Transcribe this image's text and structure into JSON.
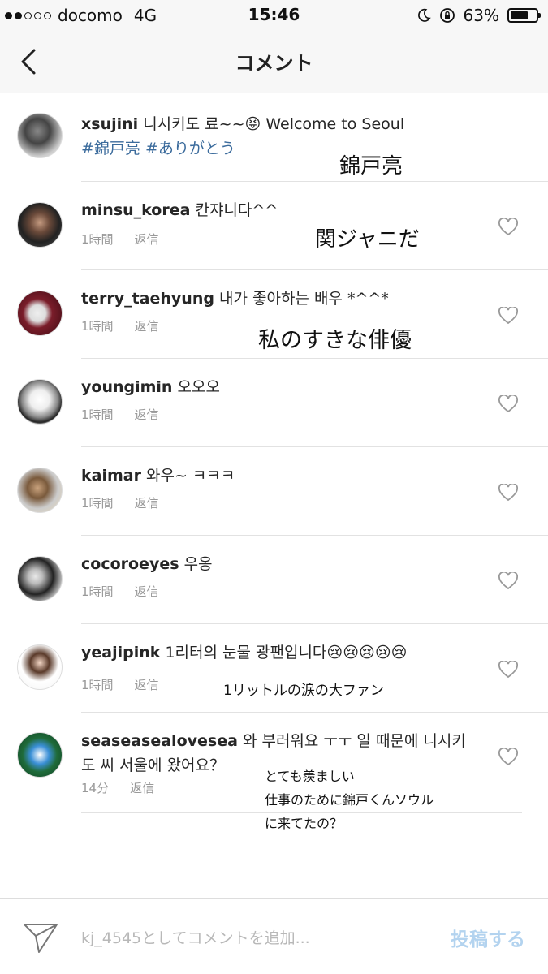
{
  "status": {
    "carrier": "docomo",
    "network": "4G",
    "time": "15:46",
    "battery": "63%",
    "battery_level": 0.63
  },
  "header": {
    "title": "コメント"
  },
  "caption": {
    "username": "xsujini",
    "text": "니시키도 료~~",
    "emoji": "😝",
    "text2": " Welcome to Seoul",
    "tags": "#錦戸亮 #ありがとう",
    "overlay": "錦戸亮"
  },
  "comments": [
    {
      "username": "minsu_korea",
      "text": " 칸쟈니다^^",
      "time": "1時間",
      "reply": "返信",
      "overlay": [
        "関ジャニだ"
      ]
    },
    {
      "username": "terry_taehyung",
      "text": " 내가 좋아하는 배우 *^^*",
      "time": "1時間",
      "reply": "返信",
      "overlay": [
        "私のすきな俳優"
      ]
    },
    {
      "username": "youngimin",
      "text": " 오오오",
      "time": "1時間",
      "reply": "返信",
      "overlay": []
    },
    {
      "username": "kaimar",
      "text": " 와우~ ㅋㅋㅋ",
      "time": "1時間",
      "reply": "返信",
      "overlay": []
    },
    {
      "username": "cocoroeyes",
      "text": " 우옹",
      "time": "1時間",
      "reply": "返信",
      "overlay": []
    },
    {
      "username": "yeajipink",
      "text": " 1리터의 눈물 광팬입니다😢😢😢😢😢",
      "time": "1時間",
      "reply": "返信",
      "overlay": [
        "1リットルの涙の大ファン"
      ]
    },
    {
      "username": "seaseasealovesea",
      "text": " 와 부러워요 ㅜㅜ 일 때문에 니시키도 씨 서울에 왔어요？",
      "time": "14分",
      "reply": "返信",
      "overlay": [
        "とても羨ましい",
        "仕事のために錦戸くんソウル",
        "に来てたの？"
      ]
    }
  ],
  "composer": {
    "placeholder": "kj_4545としてコメントを追加...",
    "post_label": "投稿する"
  },
  "colors": {
    "link": "#3b6b9c",
    "post": "#b3d3ef",
    "meta": "#999999"
  }
}
